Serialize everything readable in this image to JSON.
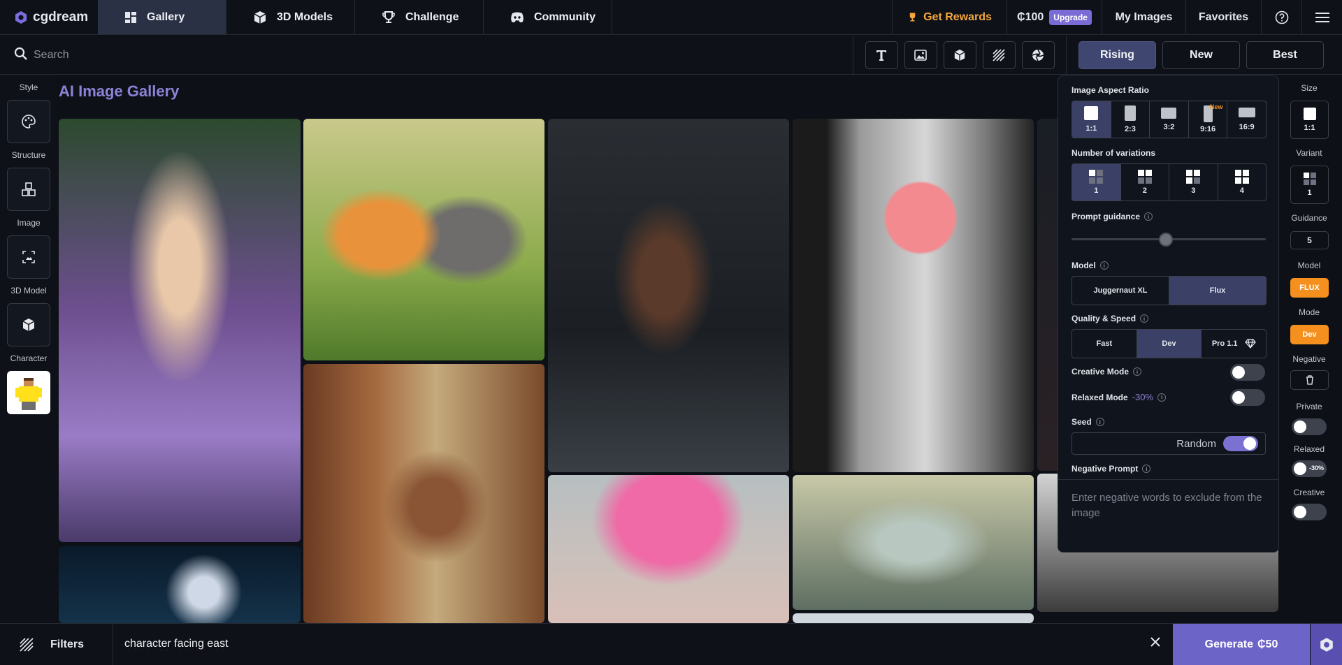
{
  "app": {
    "logo_text": "cgdream"
  },
  "nav": {
    "tabs": [
      {
        "label": "Gallery",
        "icon": "gallery-icon",
        "active": true
      },
      {
        "label": "3D Models",
        "icon": "cube-icon"
      },
      {
        "label": "Challenge",
        "icon": "trophy-icon"
      },
      {
        "label": "Community",
        "icon": "discord-icon"
      }
    ]
  },
  "topright": {
    "rewards": "Get Rewards",
    "credits": "₵100",
    "upgrade": "Upgrade",
    "my_images": "My Images",
    "favorites": "Favorites"
  },
  "search": {
    "placeholder": "Search"
  },
  "sort": {
    "rising": "Rising",
    "new": "New",
    "best": "Best",
    "active": "Rising"
  },
  "left_sidebar": {
    "style": "Style",
    "structure": "Structure",
    "image": "Image",
    "model3d": "3D Model",
    "character": "Character"
  },
  "gallery": {
    "title": "AI Image Gallery"
  },
  "panel": {
    "aspect_label": "Image Aspect Ratio",
    "aspect_options": [
      "1:1",
      "2:3",
      "3:2",
      "9:16",
      "16:9"
    ],
    "aspect_new_badge": "New",
    "variations_label": "Number of variations",
    "variation_options": [
      "1",
      "2",
      "3",
      "4"
    ],
    "guidance_label": "Prompt guidance",
    "guidance_value": 5,
    "model_label": "Model",
    "model_options": [
      "Juggernaut XL",
      "Flux"
    ],
    "quality_label": "Quality & Speed",
    "quality_options": [
      "Fast",
      "Dev",
      "Pro 1.1"
    ],
    "creative_label": "Creative Mode",
    "relaxed_label": "Relaxed Mode",
    "relaxed_discount": "-30%",
    "seed_label": "Seed",
    "seed_value": "Random",
    "negative_label": "Negative Prompt",
    "negative_placeholder": "Enter negative words to exclude from the image"
  },
  "right_sidebar": {
    "size_label": "Size",
    "size_value": "1:1",
    "variant_label": "Variant",
    "variant_value": "1",
    "guidance_label": "Guidance",
    "guidance_value": "5",
    "model_label": "Model",
    "model_value": "FLUX",
    "mode_label": "Mode",
    "mode_value": "Dev",
    "negative_label": "Negative",
    "private_label": "Private",
    "relaxed_label": "Relaxed",
    "relaxed_badge": "-30%",
    "creative_label": "Creative"
  },
  "bottom": {
    "filters": "Filters",
    "prompt_value": "character facing east",
    "generate_label": "Generate",
    "generate_cost": "₵50"
  },
  "colors": {
    "accent": "#7b6bd6",
    "orange": "#f5901e",
    "rewards": "#f6a73c",
    "title": "#8e82d8",
    "bg": "#0d1117"
  }
}
